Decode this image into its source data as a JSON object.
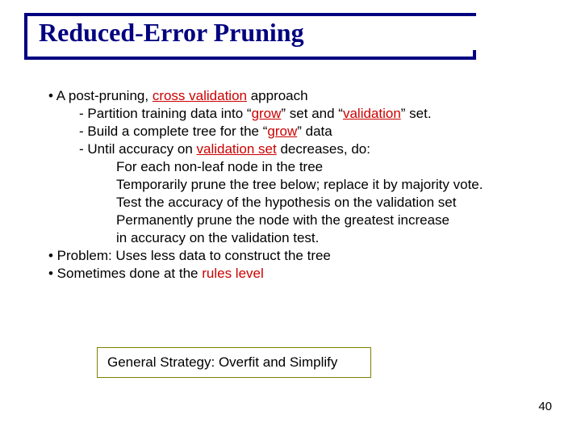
{
  "title": "Reduced-Error Pruning",
  "lines": {
    "l1a": "• A post-pruning, ",
    "l1b": "cross validation",
    "l1c": " approach",
    "l2a": "-  Partition training data into “",
    "l2b": "grow",
    "l2c": "” set and “",
    "l2d": "validation",
    "l2e": "” set.",
    "l3a": "-  Build a complete tree for the “",
    "l3b": "grow",
    "l3c": "” data",
    "l4a": "-  Until accuracy on ",
    "l4b": "validation set",
    "l4c": " decreases, do:",
    "l5": "For each non-leaf node in the tree",
    "l6": "Temporarily prune the tree below; replace it by majority vote.",
    "l7": "Test the accuracy of the hypothesis on the validation set",
    "l8": "Permanently prune the node with the greatest increase",
    "l9": "in accuracy on the validation test.",
    "l10": "• Problem: Uses less data to construct the tree",
    "l11a": "• Sometimes done at the ",
    "l11b": "rules level"
  },
  "box_text": "General Strategy: Overfit and Simplify",
  "page_number": "40"
}
